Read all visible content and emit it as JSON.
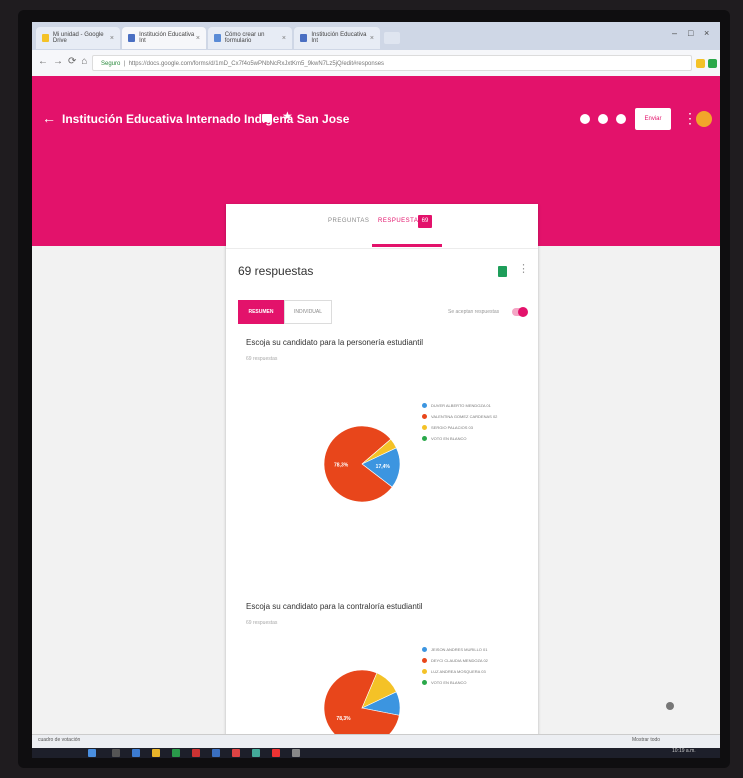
{
  "browser": {
    "tabs": [
      {
        "label": "Mi unidad - Google Drive"
      },
      {
        "label": "Institución Educativa Int"
      },
      {
        "label": "Cómo crear un formulario"
      },
      {
        "label": "Institución Educativa Int"
      }
    ],
    "url": "https://docs.google.com/forms/d/1mD_Cx7f4o5wPNbNcRxJxtKm5_9kwN7Lz5jQ/edit#responses",
    "secure_label": "Seguro"
  },
  "header": {
    "title": "Institución Educativa Internado Indígena San Jose",
    "send_label": "Enviar",
    "color": "#e3126b"
  },
  "card": {
    "tab_questions": "PREGUNTAS",
    "tab_responses": "RESPUESTAS",
    "responses_badge": "69",
    "responses_count": "69 respuestas",
    "summary_label": "RESUMEN",
    "individual_label": "INDIVIDUAL",
    "accepting_label": "Se aceptan respuestas"
  },
  "questions": [
    {
      "title": "Escoja su candidato para la personería estudiantil",
      "subtitle": "69 respuestas",
      "legend": [
        "DUVER ALBERTO MENDOZA 01",
        "VALENTINA GOMEZ CARDENAS 02",
        "SERGIO PALACIOS 03",
        "VOTO EN BLANCO"
      ],
      "slice_labels": [
        "78,3%",
        "17,4%"
      ]
    },
    {
      "title": "Escoja su candidato para la contraloría estudiantil",
      "subtitle": "69 respuestas",
      "legend": [
        "JEISON ANDRES MURILLO 01",
        "DEYCI CLAUDIA MENDOZA 02",
        "LUZ ANDREA MOSQUERA 03",
        "VOTO EN BLANCO"
      ],
      "slice_labels": [
        "78,3%"
      ]
    }
  ],
  "chart_data": [
    {
      "type": "pie",
      "title": "Escoja su candidato para la personería estudiantil",
      "categories": [
        "DUVER ALBERTO MENDOZA 01",
        "VALENTINA GOMEZ CARDENAS 02",
        "SERGIO PALACIOS 03",
        "VOTO EN BLANCO"
      ],
      "values": [
        17.4,
        78.3,
        4.3,
        0
      ],
      "colors": [
        "#3c95e0",
        "#e8461b",
        "#f4c227",
        "#2aa84a"
      ],
      "legend": "right"
    },
    {
      "type": "pie",
      "title": "Escoja su candidato para la contraloría estudiantil",
      "categories": [
        "JEISON ANDRES MURILLO 01",
        "DEYCI CLAUDIA MENDOZA 02",
        "LUZ ANDREA MOSQUERA 03",
        "VOTO EN BLANCO"
      ],
      "values": [
        10.1,
        78.3,
        11.6,
        0
      ],
      "colors": [
        "#3c95e0",
        "#e8461b",
        "#f4c227",
        "#2aa84a"
      ],
      "legend": "right"
    }
  ],
  "download_bar": {
    "item": "cuadro de votación",
    "show_all": "Mostrar todo"
  },
  "taskbar": {
    "time": "10:19 a.m."
  }
}
